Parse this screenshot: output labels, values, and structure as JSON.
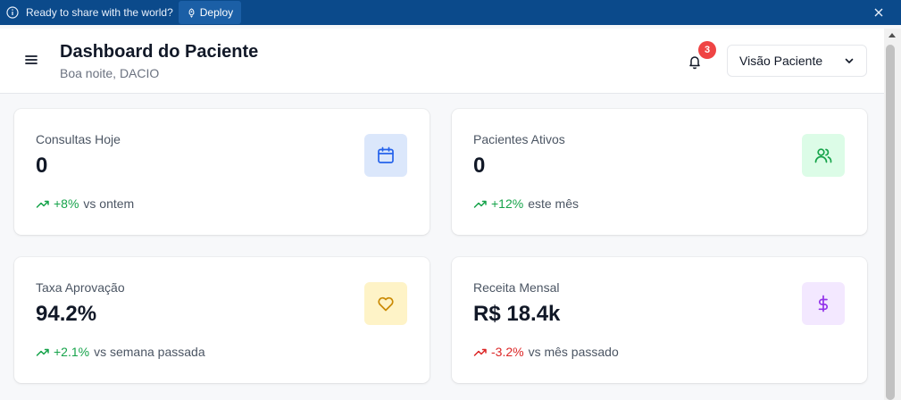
{
  "banner": {
    "message": "Ready to share with the world?",
    "deploy_label": "Deploy"
  },
  "header": {
    "title": "Dashboard do Paciente",
    "subtitle": "Boa noite, DACIO",
    "notification_count": "3",
    "view_select": "Visão Paciente"
  },
  "cards": [
    {
      "label": "Consultas Hoje",
      "value": "0",
      "trend_pct": "+8%",
      "trend_text": "vs ontem",
      "trend_dir": "up",
      "icon": "calendar-icon",
      "icon_bg": "#dbe7fb",
      "icon_color": "#2563eb"
    },
    {
      "label": "Pacientes Ativos",
      "value": "0",
      "trend_pct": "+12%",
      "trend_text": "este mês",
      "trend_dir": "up",
      "icon": "users-icon",
      "icon_bg": "#dcfce7",
      "icon_color": "#16a34a"
    },
    {
      "label": "Taxa Aprovação",
      "value": "94.2%",
      "trend_pct": "+2.1%",
      "trend_text": "vs semana passada",
      "trend_dir": "up",
      "icon": "heart-icon",
      "icon_bg": "#fef3c7",
      "icon_color": "#ca8a04"
    },
    {
      "label": "Receita Mensal",
      "value": "R$ 18.4k",
      "trend_pct": "-3.2%",
      "trend_text": "vs mês passado",
      "trend_dir": "down",
      "icon": "dollar-icon",
      "icon_bg": "#f3e8ff",
      "icon_color": "#9333ea"
    }
  ],
  "colors": {
    "banner_bg": "#0b4a8b",
    "positive": "#16a34a",
    "negative": "#dc2626",
    "badge": "#ef4444"
  }
}
